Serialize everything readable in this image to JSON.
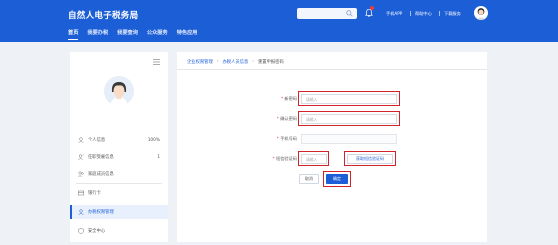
{
  "header": {
    "site_title": "自然人电子税务局",
    "nav": [
      "首页",
      "我要办税",
      "我要查询",
      "公众服务",
      "特色应用"
    ],
    "links": {
      "app": "手机APP",
      "help": "帮助中心",
      "download": "下载服务"
    },
    "icons": [
      "search-icon",
      "bell-icon",
      "avatar"
    ],
    "notification_dot_color": "#f03a3a"
  },
  "sidebar": {
    "items": [
      {
        "label": "个人信息",
        "count": "100%",
        "icon": "user-icon"
      },
      {
        "label": "任职受雇信息",
        "count": "1",
        "icon": "user-group-icon"
      },
      {
        "label": "家庭成员信息",
        "count": "",
        "icon": "family-icon"
      },
      {
        "label": "银行卡",
        "count": "",
        "icon": "card-icon"
      },
      {
        "label": "办税权限管理",
        "count": "",
        "icon": "shield-icon"
      },
      {
        "label": "安全中心",
        "count": "",
        "icon": "lock-icon"
      }
    ],
    "active_index": 4
  },
  "breadcrumb": [
    "企业权限管理",
    "办税人员信息",
    "重置申报密码"
  ],
  "form": {
    "new_password_label": "新密码",
    "new_password_placeholder": "请输入",
    "confirm_password_label": "确认密码",
    "confirm_password_placeholder": "请输入",
    "phone_label": "手机号码",
    "phone_value": "",
    "sms_label": "短信验证码",
    "sms_placeholder": "请输入",
    "get_code_button": "获取短信验证码",
    "cancel_button": "取消",
    "confirm_button": "确定"
  },
  "colors": {
    "primary": "#1c5ed6",
    "highlight": "#d2232a"
  }
}
